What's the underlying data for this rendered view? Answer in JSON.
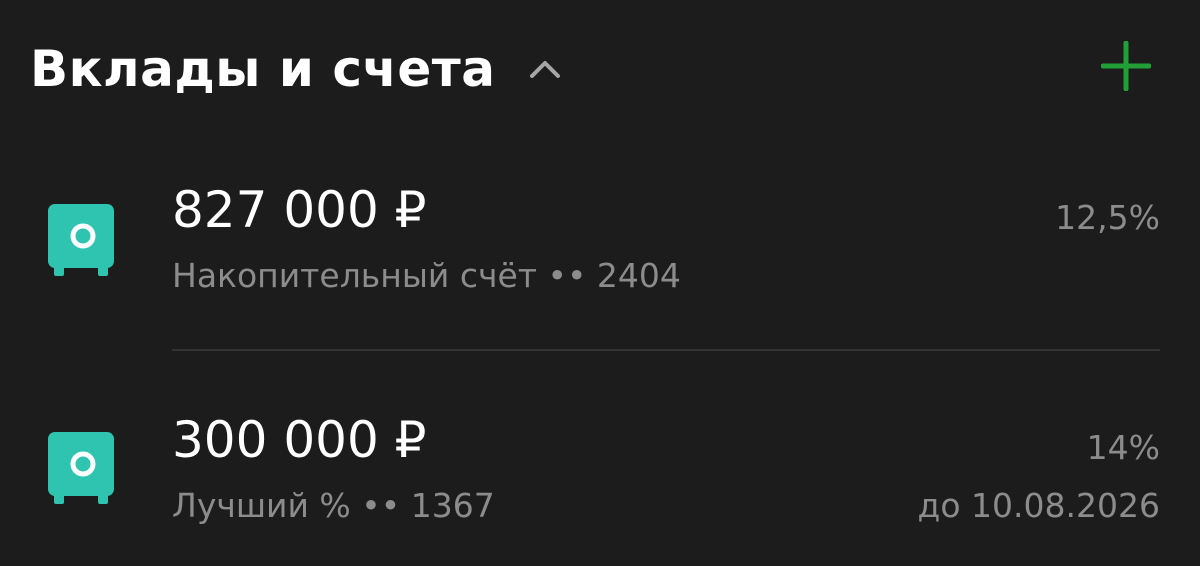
{
  "header": {
    "title": "Вклады и счета",
    "collapse_icon": "chevron-up-icon",
    "add_icon": "plus-icon"
  },
  "colors": {
    "background": "#1c1c1c",
    "accent_green": "#21a038",
    "icon_teal": "#2ec4b0",
    "secondary_text": "#8c8c8c"
  },
  "accounts": [
    {
      "amount": "827 000 ₽",
      "name": "Накопительный счёт",
      "separator": "••",
      "number": "2404",
      "rate": "12,5%",
      "maturity": "",
      "icon": "safe-icon"
    },
    {
      "amount": "300 000 ₽",
      "name": "Лучший %",
      "separator": "••",
      "number": "1367",
      "rate": "14%",
      "maturity": "до 10.08.2026",
      "icon": "safe-icon"
    }
  ]
}
